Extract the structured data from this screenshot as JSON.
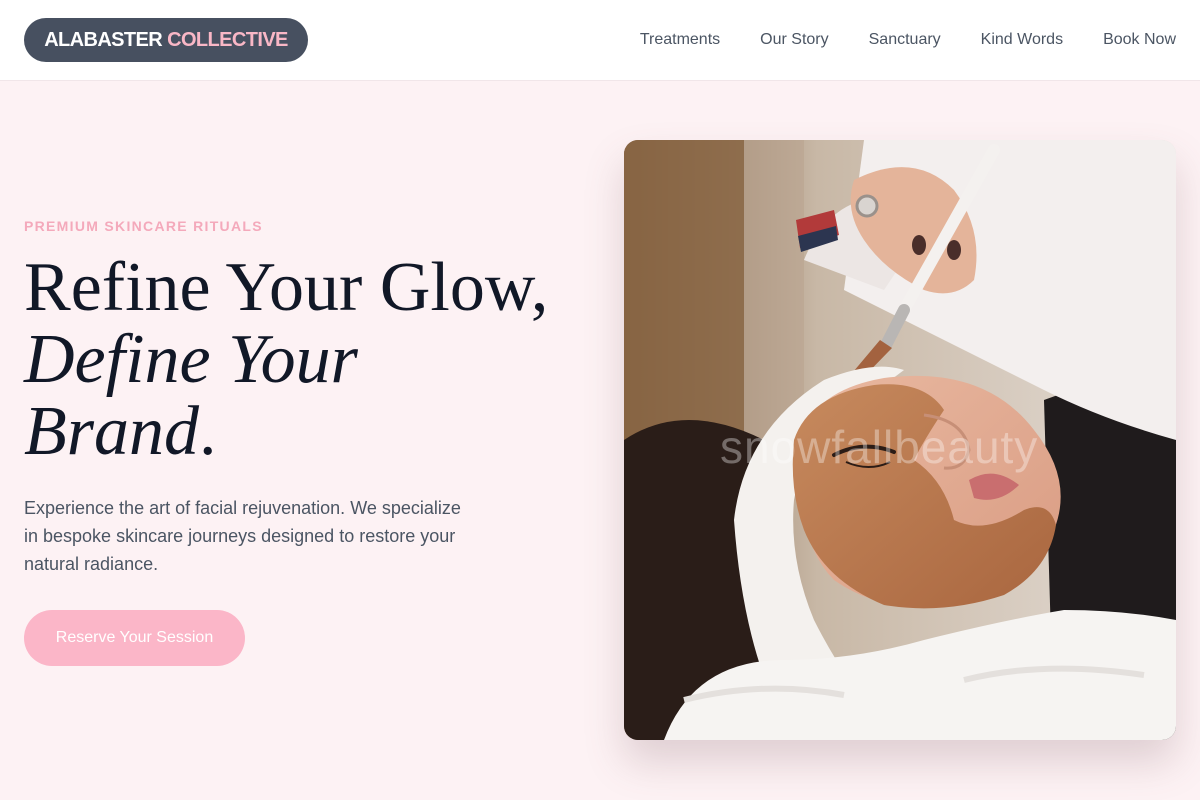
{
  "brand": {
    "name_part1": "ALABASTER",
    "name_part2": "COLLECTIVE"
  },
  "nav": {
    "items": [
      {
        "label": "Treatments"
      },
      {
        "label": "Our Story"
      },
      {
        "label": "Sanctuary"
      },
      {
        "label": "Kind Words"
      },
      {
        "label": "Book Now"
      }
    ]
  },
  "hero": {
    "eyebrow": "PREMIUM SKINCARE RITUALS",
    "headline_line1": "Refine Your Glow,",
    "headline_line2": "Define Your",
    "headline_line3": "Brand",
    "headline_period": ".",
    "description": "Experience the art of facial rejuvenation. We specialize in bespoke skincare journeys designed to restore your natural radiance.",
    "cta_label": "Reserve Your Session",
    "image": {
      "alt": "Woman receiving a clay facial mask treatment with a brush",
      "watermark": "snowfallbeauty"
    }
  },
  "colors": {
    "accent": "#fbb6c8",
    "eyebrow": "#f4a9bb",
    "logo_bg": "#475060",
    "page_bg": "#fdf2f4"
  }
}
